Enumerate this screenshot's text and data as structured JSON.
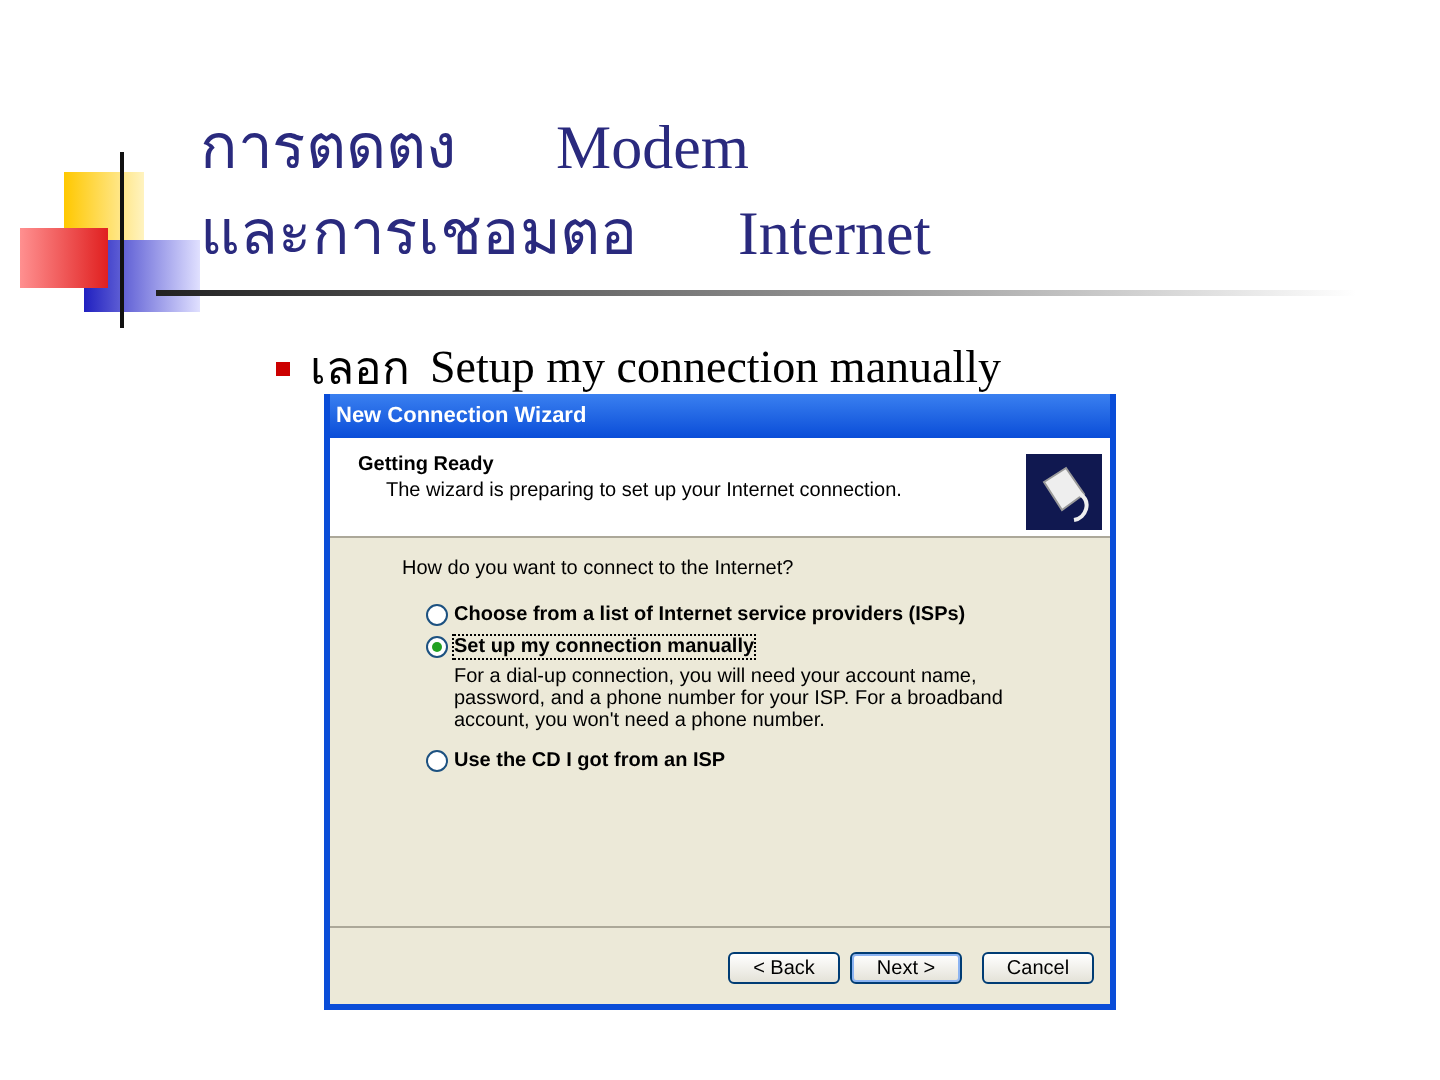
{
  "slide": {
    "title_lines": [
      {
        "thai": "การตดตง",
        "english": "Modem"
      },
      {
        "thai": "และการเชอมตอ",
        "english": "Internet"
      }
    ],
    "bullet": {
      "thai": "เลอก",
      "english": "Setup my connection manually"
    }
  },
  "wizard": {
    "title": "New Connection Wizard",
    "heading": "Getting Ready",
    "subheading": "The wizard is preparing to set up your Internet connection.",
    "question": "How do you want to connect to the Internet?",
    "options": [
      {
        "label": "Choose from a list of Internet service providers (ISPs)",
        "selected": false
      },
      {
        "label": "Set up my connection manually",
        "selected": true,
        "description": "For a dial-up connection, you will need your account name, password, and a phone number for your ISP. For a broadband account, you won't need a phone number."
      },
      {
        "label": "Use the CD I got from an ISP",
        "selected": false
      }
    ],
    "buttons": [
      {
        "label": "< Back",
        "kind": "back"
      },
      {
        "label": "Next >",
        "kind": "default"
      },
      {
        "label": "Cancel",
        "kind": "cancel"
      }
    ]
  }
}
